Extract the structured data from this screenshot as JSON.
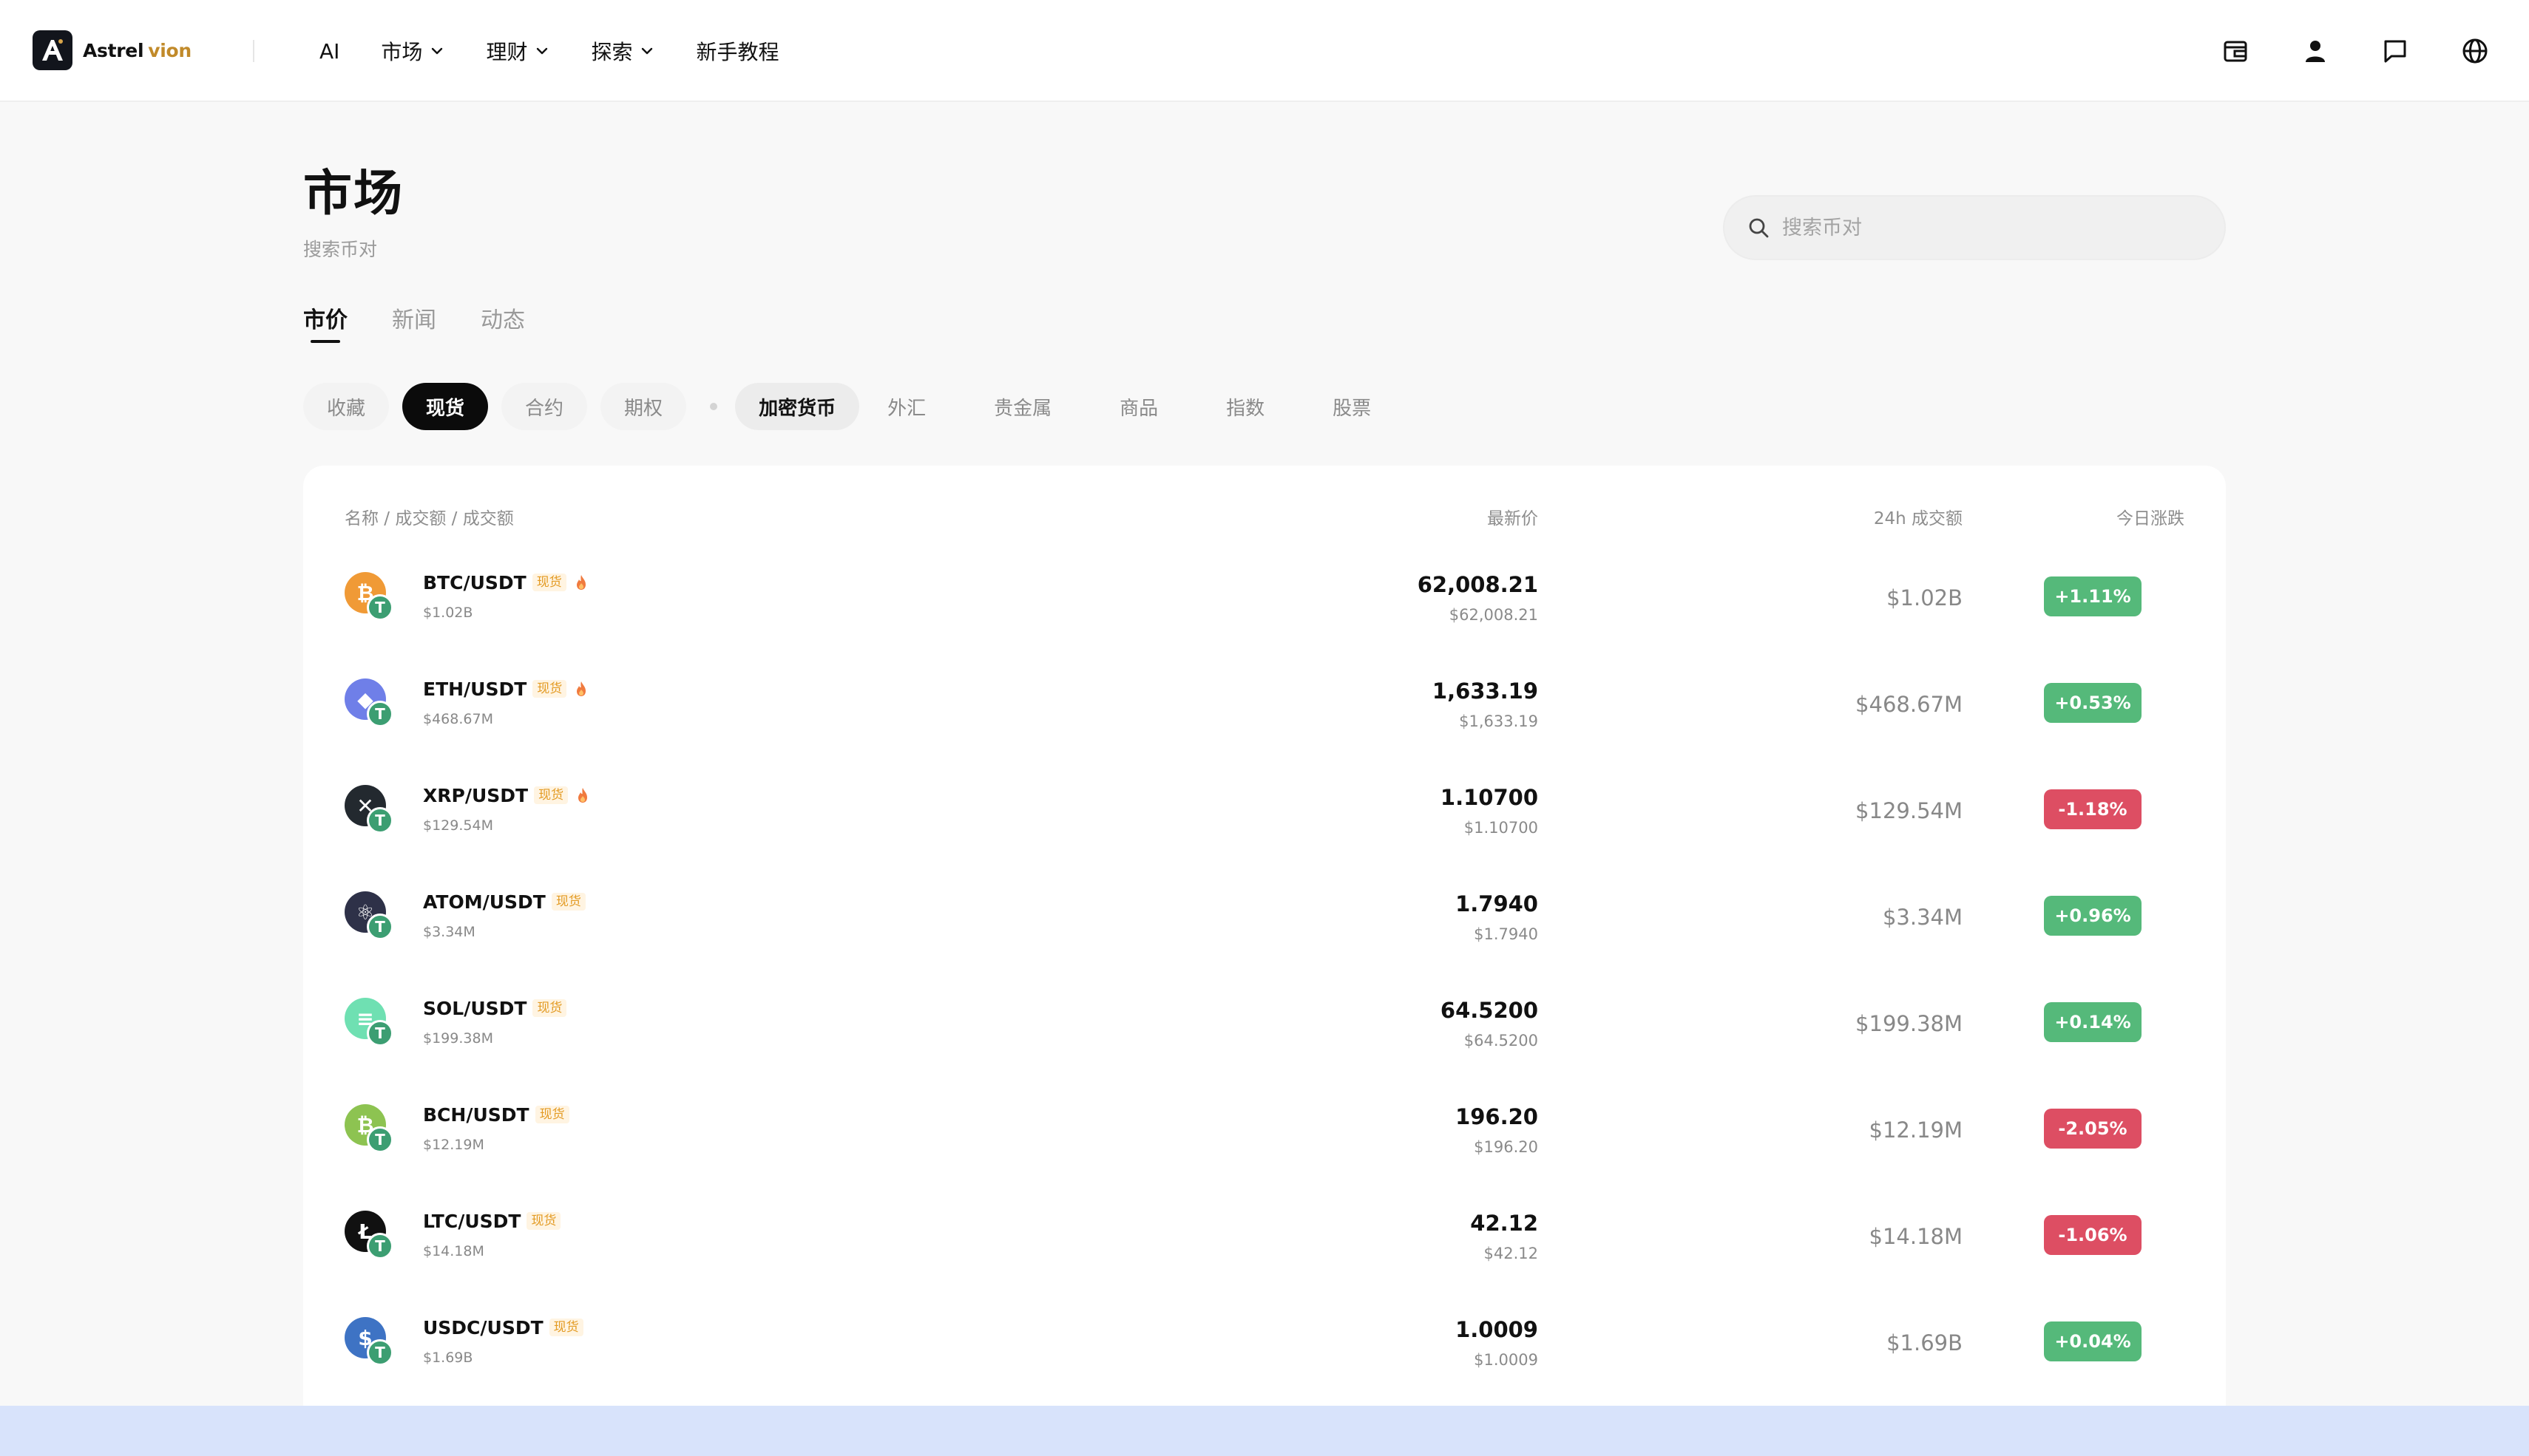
{
  "brand": {
    "name_part1": "Astrel",
    "name_part2": "vion"
  },
  "nav": [
    {
      "label": "AI",
      "has_menu": false
    },
    {
      "label": "市场",
      "has_menu": true
    },
    {
      "label": "理财",
      "has_menu": true
    },
    {
      "label": "探索",
      "has_menu": true
    },
    {
      "label": "新手教程",
      "has_menu": false
    }
  ],
  "header_icons": [
    "wallet-icon",
    "user-icon",
    "message-icon",
    "globe-icon"
  ],
  "page": {
    "title": "市场",
    "subtitle": "搜索币对"
  },
  "search": {
    "placeholder": "搜索币对",
    "value": ""
  },
  "tabs": [
    {
      "label": "市价",
      "active": true
    },
    {
      "label": "新闻",
      "active": false
    },
    {
      "label": "动态",
      "active": false
    }
  ],
  "chips": {
    "group1": [
      {
        "label": "收藏",
        "state": "default"
      },
      {
        "label": "现货",
        "state": "active"
      },
      {
        "label": "合约",
        "state": "default"
      },
      {
        "label": "期权",
        "state": "default"
      }
    ],
    "group2": [
      {
        "label": "加密货币",
        "state": "selected"
      },
      {
        "label": "外汇",
        "state": "plain"
      },
      {
        "label": "贵金属",
        "state": "plain"
      },
      {
        "label": "商品",
        "state": "plain"
      },
      {
        "label": "指数",
        "state": "plain"
      },
      {
        "label": "股票",
        "state": "plain"
      }
    ]
  },
  "table": {
    "headers": {
      "name": "名称 / 成交额 / 成交额",
      "price": "最新价",
      "volume": "24h 成交额",
      "change": "今日涨跌"
    },
    "rows": [
      {
        "pair": "BTC/USDT",
        "tag": "现货",
        "hot": true,
        "volume_small": "$1.02B",
        "price": "62,008.21",
        "price_usd": "$62,008.21",
        "volume_24h": "$1.02B",
        "change": "+1.11%",
        "direction": "up",
        "coin_color": "#f09a36",
        "coin_symbol": "₿"
      },
      {
        "pair": "ETH/USDT",
        "tag": "现货",
        "hot": true,
        "volume_small": "$468.67M",
        "price": "1,633.19",
        "price_usd": "$1,633.19",
        "volume_24h": "$468.67M",
        "change": "+0.53%",
        "direction": "up",
        "coin_color": "#6f7fe8",
        "coin_symbol": "◆"
      },
      {
        "pair": "XRP/USDT",
        "tag": "现货",
        "hot": true,
        "volume_small": "$129.54M",
        "price": "1.10700",
        "price_usd": "$1.10700",
        "volume_24h": "$129.54M",
        "change": "-1.18%",
        "direction": "down",
        "coin_color": "#23292f",
        "coin_symbol": "✕"
      },
      {
        "pair": "ATOM/USDT",
        "tag": "现货",
        "hot": false,
        "volume_small": "$3.34M",
        "price": "1.7940",
        "price_usd": "$1.7940",
        "volume_24h": "$3.34M",
        "change": "+0.96%",
        "direction": "up",
        "coin_color": "#2e3148",
        "coin_symbol": "⚛"
      },
      {
        "pair": "SOL/USDT",
        "tag": "现货",
        "hot": false,
        "volume_small": "$199.38M",
        "price": "64.5200",
        "price_usd": "$64.5200",
        "volume_24h": "$199.38M",
        "change": "+0.14%",
        "direction": "up",
        "coin_color": "#6fe0b2",
        "coin_symbol": "≡"
      },
      {
        "pair": "BCH/USDT",
        "tag": "现货",
        "hot": false,
        "volume_small": "$12.19M",
        "price": "196.20",
        "price_usd": "$196.20",
        "volume_24h": "$12.19M",
        "change": "-2.05%",
        "direction": "down",
        "coin_color": "#8dc351",
        "coin_symbol": "₿"
      },
      {
        "pair": "LTC/USDT",
        "tag": "现货",
        "hot": false,
        "volume_small": "$14.18M",
        "price": "42.12",
        "price_usd": "$42.12",
        "volume_24h": "$14.18M",
        "change": "-1.06%",
        "direction": "down",
        "coin_color": "#111111",
        "coin_symbol": "Ł"
      },
      {
        "pair": "USDC/USDT",
        "tag": "现货",
        "hot": false,
        "volume_small": "$1.69B",
        "price": "1.0009",
        "price_usd": "$1.0009",
        "volume_24h": "$1.69B",
        "change": "+0.04%",
        "direction": "up",
        "coin_color": "#3e73c4",
        "coin_symbol": "$"
      }
    ]
  },
  "colors": {
    "up": "#55b97a",
    "down": "#dd4e63",
    "brand_gold": "#c18a2a",
    "tag_orange": "#e39a22",
    "tether": "#3c9e72"
  }
}
